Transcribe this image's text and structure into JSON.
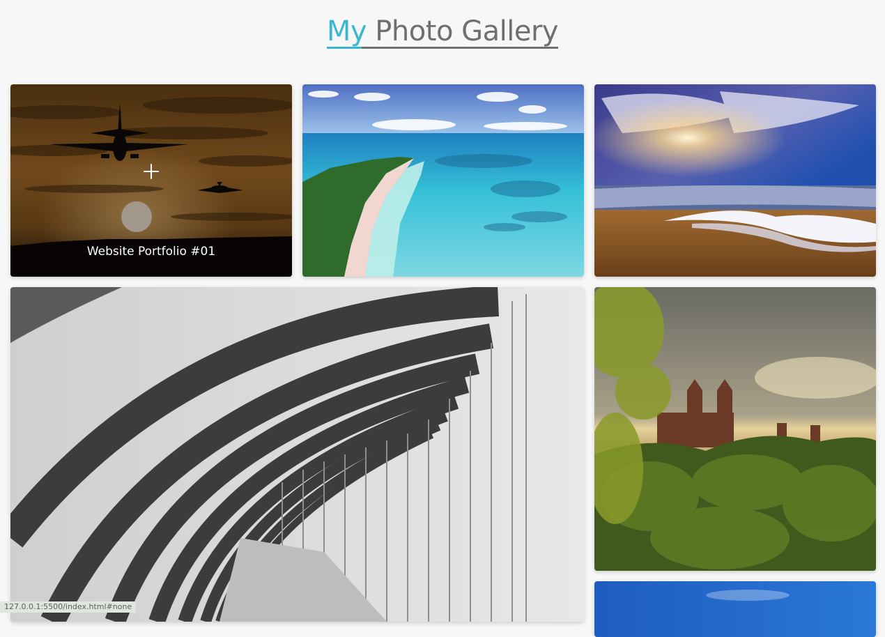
{
  "header": {
    "title_accent": "My",
    "title_rest": " Photo Gallery"
  },
  "gallery": {
    "items": [
      {
        "caption": "Website Portfolio #01",
        "overlay_icon": "plus-icon",
        "subject": "airplanes-sunset"
      },
      {
        "subject": "tropical-beach"
      },
      {
        "subject": "beach-sunset"
      },
      {
        "subject": "concrete-arch-tunnel"
      },
      {
        "subject": "castle-forest"
      },
      {
        "subject": "blue-sky"
      }
    ]
  },
  "status": {
    "url": "127.0.0.1:5500/index.html#none"
  },
  "colors": {
    "accent": "#3bb6d0",
    "title_gray": "#6f6f6f",
    "background": "#f7f7f7"
  }
}
